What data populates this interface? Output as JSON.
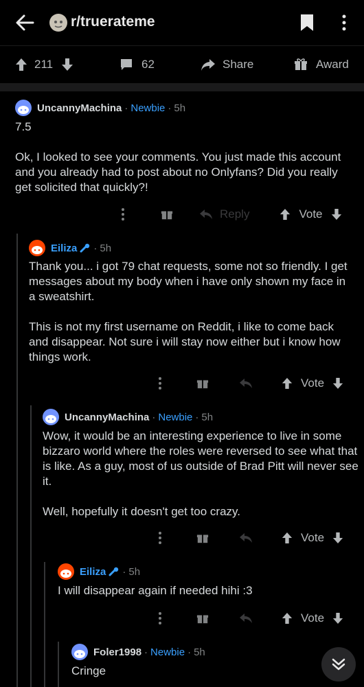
{
  "header": {
    "subreddit": "r/truerateme"
  },
  "post_actions": {
    "upvotes": "211",
    "comments": "62",
    "share": "Share",
    "award": "Award"
  },
  "comments": [
    {
      "user": "UncannyMachina",
      "flair": "Newbie",
      "time": "5h",
      "body": "7.5\n\nOk, I looked to see your comments. You just made this account and you already had to post about no Onlyfans? Did you really get solicited that quickly?!",
      "reply": "Reply",
      "vote": "Vote"
    },
    {
      "user": "Eiliza",
      "time": "5h",
      "body": "Thank you... i got 79 chat requests, some not so friendly. I get messages about my body when i have only shown my face in a sweatshirt.\n\nThis is not my first username on Reddit, i like to come back and disappear. Not sure i will stay now either but i know how things work.",
      "vote": "Vote"
    },
    {
      "user": "UncannyMachina",
      "flair": "Newbie",
      "time": "5h",
      "body": "Wow, it would be an interesting experience to live in some bizzaro world where the roles were reversed to see what that is like. As a guy, most of us outside of Brad Pitt will never see  it.\n\nWell, hopefully it doesn't get too crazy.",
      "vote": "Vote"
    },
    {
      "user": "Eiliza",
      "time": "5h",
      "body": "I will disappear again if needed hihi :3",
      "vote": "Vote"
    },
    {
      "user": "Foler1998",
      "flair": "Newbie",
      "time": "5h",
      "body": "Cringe"
    }
  ],
  "colors": {
    "accent": "#3aa0ff",
    "op_avatar": "#ff4500",
    "user_avatar": "#7193ff"
  }
}
